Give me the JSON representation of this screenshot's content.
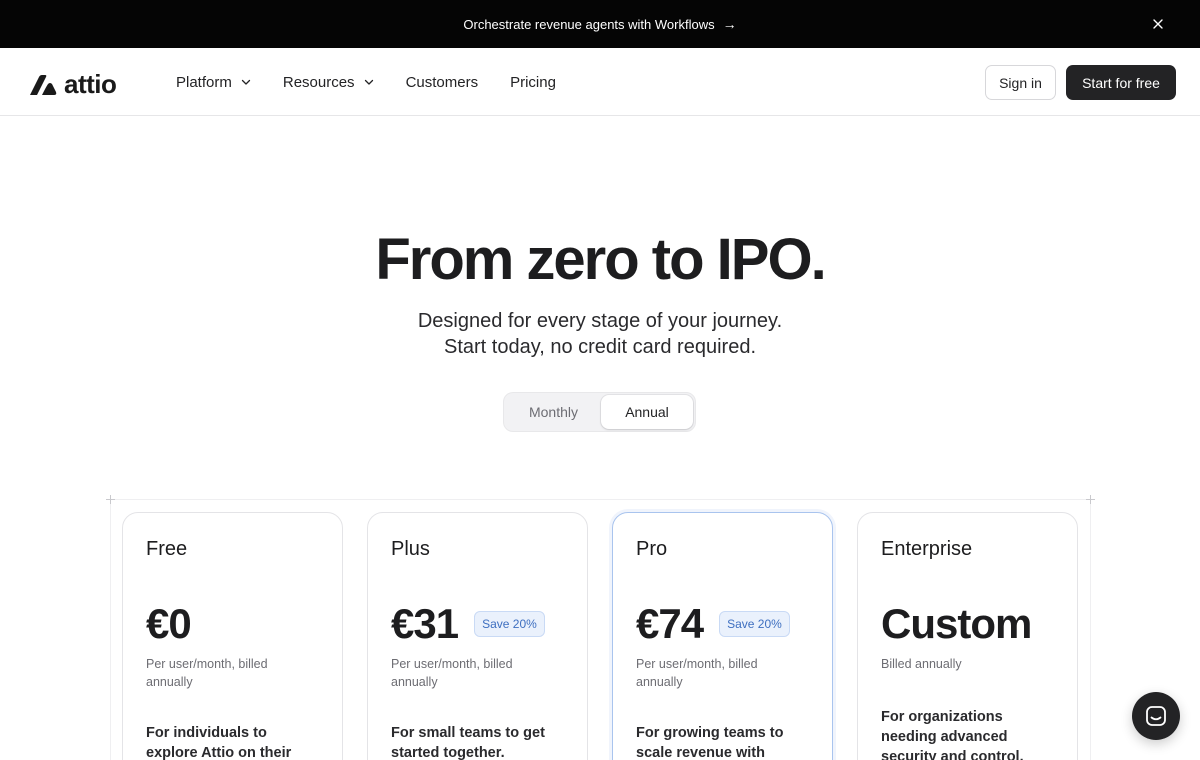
{
  "announcement": {
    "text": "Orchestrate revenue agents with Workflows",
    "arrow": "→"
  },
  "brand": {
    "name": "attio"
  },
  "nav": {
    "items": [
      {
        "label": "Platform",
        "has_dropdown": true
      },
      {
        "label": "Resources",
        "has_dropdown": true
      },
      {
        "label": "Customers",
        "has_dropdown": false
      },
      {
        "label": "Pricing",
        "has_dropdown": false
      }
    ],
    "sign_in": "Sign in",
    "start": "Start for free"
  },
  "hero": {
    "title": "From zero to IPO.",
    "subtitle_line1": "Designed for every stage of your journey.",
    "subtitle_line2": "Start today, no credit card required."
  },
  "billing_toggle": {
    "options": [
      "Monthly",
      "Annual"
    ],
    "selected": "Annual"
  },
  "plans": [
    {
      "name": "Free",
      "price": "€0",
      "badge": "",
      "note": "Per user/month, billed annually",
      "description": "For individuals to explore Attio on their own."
    },
    {
      "name": "Plus",
      "price": "€31",
      "badge": "Save 20%",
      "note": "Per user/month, billed annually",
      "description": "For small teams to get started together."
    },
    {
      "name": "Pro",
      "price": "€74",
      "badge": "Save 20%",
      "note": "Per user/month, billed annually",
      "description": "For growing teams to scale revenue with automation."
    },
    {
      "name": "Enterprise",
      "price": "Custom",
      "badge": "",
      "note": "Billed annually",
      "description": "For organizations needing advanced security and control."
    }
  ],
  "colors": {
    "accent_blue": "#3e6fc0",
    "dark": "#232325",
    "announce_bg": "#050505"
  }
}
